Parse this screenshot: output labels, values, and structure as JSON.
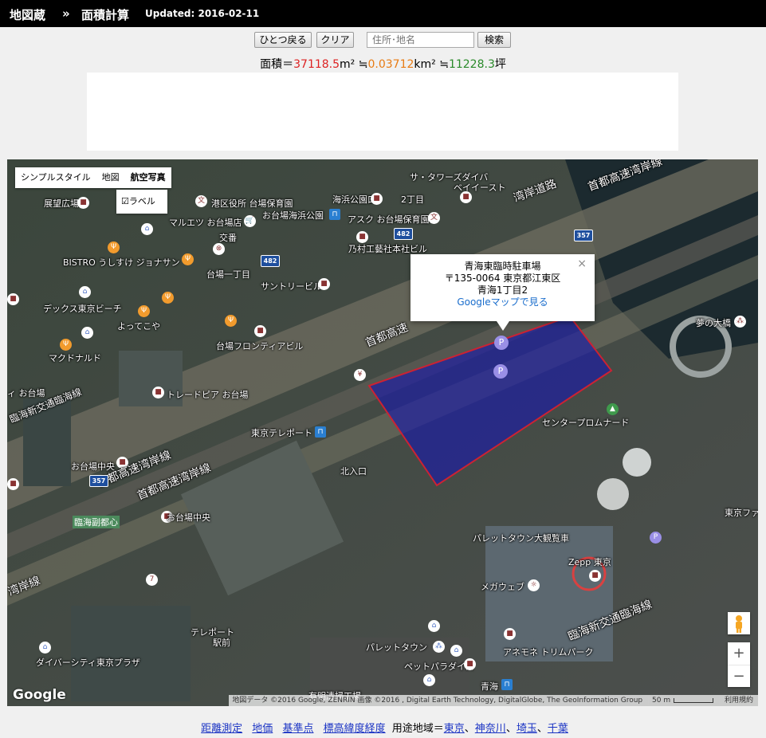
{
  "header": {
    "site": "地図蔵",
    "separator": "»",
    "page": "面積計算",
    "updated": "Updated: 2016-02-11"
  },
  "toolbar": {
    "undo_label": "ひとつ戻る",
    "clear_label": "クリア",
    "search_placeholder": "住所･地名",
    "search_label": "検索"
  },
  "area": {
    "label": "面積＝",
    "m2_value": "37118.5",
    "m2_unit": "m² ≒",
    "km2_value": "0.03712",
    "km2_unit": "km² ≒",
    "tsubo_value": "11228.3",
    "tsubo_unit": "坪"
  },
  "map": {
    "type_buttons": [
      "シンプルスタイル",
      "地図",
      "航空写真"
    ],
    "label_toggle": "ラベル",
    "google_logo": "Google",
    "attribution": "地図データ ©2016 Google, ZENRIN 画像 ©2016 , Digital Earth Technology, DigitalGlobe, The GeoInformation Group",
    "scale": "50 m",
    "terms": "利用規約",
    "zoom_in": "+",
    "zoom_out": "−",
    "infowindow": {
      "title": "青海東臨時駐車場",
      "line1": "〒135-0064 東京都江東区",
      "line2": "青海1丁目2",
      "link": "Googleマップで見る",
      "close": "×"
    },
    "labels": {
      "tenbodai": "展望広場",
      "minato": "港区役所 台場保育園",
      "kaihin": "海浜公園口",
      "chome2": "2丁目",
      "sun_towers": "サ・タワーズダイバ",
      "bayeast": "ベイイースト",
      "wangan": "湾岸道路",
      "shuto": "首都高速湾岸線",
      "maruetsu": "マルエツ お台場店",
      "odaiba_park": "お台場海浜公園",
      "ask": "アスク お台場保育園",
      "koban": "交番",
      "norimura": "乃村工藝社本社ビル",
      "bistro": "BISTRO うしすけ ジョナサン",
      "daiba1": "台場一丁目",
      "sunroad": "サントリービル",
      "decks": "デックス東京ビーチ",
      "yottekoya": "よってこや",
      "mac": "マクドナルド",
      "frontier": "台場フロンティアビル",
      "shuto2": "首都高速",
      "yume": "夢の大橋",
      "odaiba": "ィ お台場",
      "trade": "トレードピア お台場",
      "rinkai": "臨海新交通臨海線",
      "centerprom": "センタープロムナード",
      "teleport": "東京テレポート",
      "kitairi": "北入口",
      "odaibanaka": "お台場中央",
      "shuto3": "首都高速湾岸線",
      "shuto4": "首都高速湾岸線",
      "rinkaifuku": "臨海副都心",
      "odaibakaihin": "お台場中央",
      "palette": "パレットタウン大観覧車",
      "zepp": "Zepp 東京",
      "megaweb": "メガウェブ",
      "tokyofashion": "東京ファッションタウン",
      "wangansen": "湾岸線",
      "teleport2": "テレポート",
      "ekimae": "駅前",
      "rinkai2": "臨海新交通臨海線",
      "palettetown": "パレットタウン",
      "petparadise": "ペットパラダイス",
      "anemone": "アネモネ トリムパーク",
      "divercity": "ダイバーシティ東京プラザ",
      "aomi": "青海",
      "ariake": "有明清掃工場",
      "r482": "482",
      "r357": "357"
    }
  },
  "footer": {
    "links": [
      "距離測定",
      "地価",
      "基準点",
      "標高緯度経度"
    ],
    "zoning_label": "用途地域＝",
    "zoning_links": [
      "東京",
      "神奈川",
      "埼玉",
      "千葉"
    ],
    "sep": "、"
  },
  "colors": {
    "area_m2": "#dd2222",
    "area_km2": "#e87b13",
    "area_tsubo": "#2a8a2a",
    "polygon_fill": "#1a1aa8",
    "polygon_stroke": "#cc2233",
    "link": "#1a33c4"
  }
}
